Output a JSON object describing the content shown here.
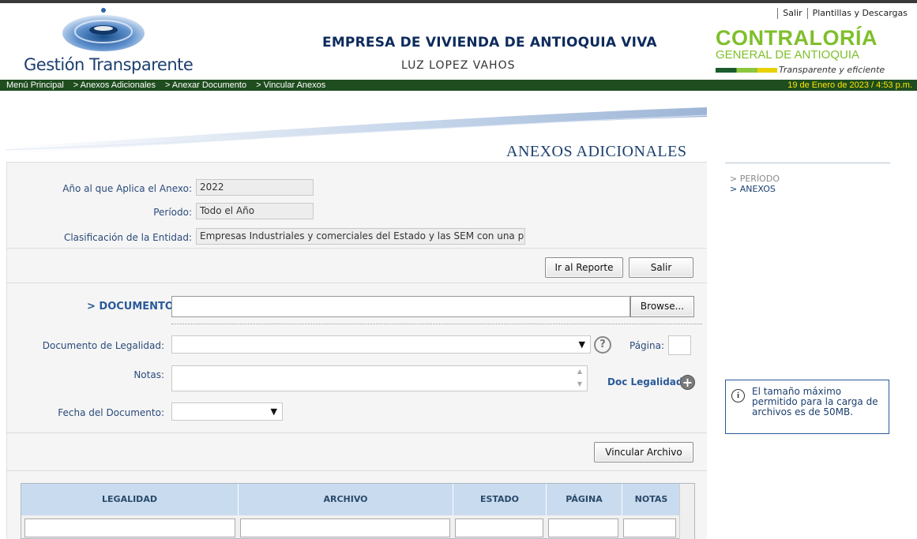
{
  "header": {
    "top_links": [
      "Salir",
      "Plantillas y Descargas"
    ],
    "brand": "Gestión Transparente",
    "entity_name": "EMPRESA DE VIVIENDA DE ANTIOQUIA VIVA",
    "user_name": "LUZ LOPEZ VAHOS",
    "contraloria_line1": "CONTRALORÍA",
    "contraloria_line2": "GENERAL DE ANTIOQUIA",
    "contraloria_tagline": "Transparente y eficiente"
  },
  "navbar": {
    "crumbs": [
      "Menú Principal",
      "> Anexos Adicionales",
      "> Anexar Documento",
      "> Vincular Anexos"
    ],
    "datetime": "19 de Enero de 2023 / 4:53 p.m."
  },
  "page": {
    "title": "ANEXOS ADICIONALES"
  },
  "form": {
    "anio_label": "Año al que Aplica el Anexo:",
    "anio_value": "2022",
    "periodo_label": "Período:",
    "periodo_value": "Todo el Año",
    "clasificacion_label": "Clasificación de la Entidad:",
    "clasificacion_value": "Empresas Industriales y comerciales del Estado y las SEM con una p",
    "ir_reporte": "Ir al Reporte",
    "salir": "Salir",
    "documento_label": "> DOCUMENTO",
    "browse": "Browse...",
    "doc_legalidad_label": "Documento de Legalidad:",
    "pagina_label": "Página:",
    "notas_label": "Notas:",
    "doc_legalidad_link": "Doc Legalidad",
    "fecha_label": "Fecha del Documento:",
    "vincular": "Vincular Archivo"
  },
  "sidebar": {
    "items": [
      "> PERÍODO",
      "> ANEXOS"
    ],
    "info": "El tamaño máximo permitido para la carga de archivos es de 50MB."
  },
  "table": {
    "columns": [
      "LEGALIDAD",
      "ARCHIVO",
      "ESTADO",
      "PÁGINA",
      "NOTAS"
    ]
  },
  "colors": {
    "navbar_bg": "#1f4d1f",
    "navbar_date": "#ffe400",
    "accent_blue": "#1c3f6e",
    "contraloria_green": "#7fbf2a",
    "table_header": "#c9dbef"
  }
}
